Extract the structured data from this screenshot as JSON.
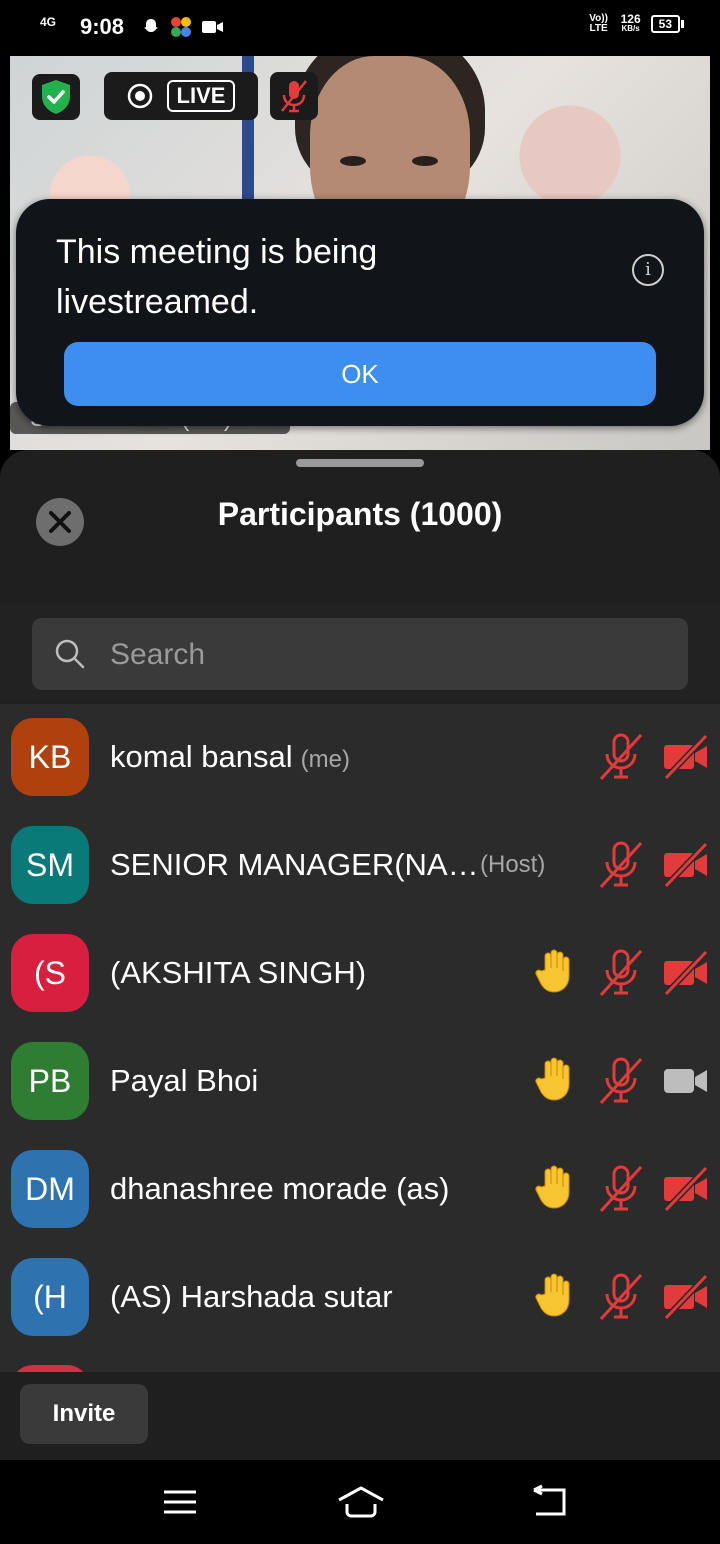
{
  "status_bar": {
    "network": "4G",
    "time": "9:08",
    "volte": "Vo)) LTE",
    "speed_value": "126",
    "speed_unit": "KB/s",
    "battery": "53"
  },
  "video": {
    "live_label": "LIVE",
    "participant_name_tag": "Shalini Yadav (Alh)"
  },
  "toast": {
    "message": "This meeting is being livestreamed.",
    "ok_label": "OK"
  },
  "participants_panel": {
    "title": "Participants (1000)",
    "search_placeholder": "Search",
    "invite_label": "Invite",
    "participants": [
      {
        "initials": "KB",
        "name": "komal bansal",
        "tag": "(me)",
        "role": "",
        "color": "#b0410e",
        "hand": false,
        "mic_muted": true,
        "cam_off": true
      },
      {
        "initials": "SM",
        "name": "SENIOR MANAGER(NA…",
        "tag": "",
        "role": "(Host)",
        "color": "#0a7a79",
        "hand": false,
        "mic_muted": true,
        "cam_off": true
      },
      {
        "initials": "(S",
        "name": "(AKSHITA SINGH)",
        "tag": "",
        "role": "",
        "color": "#d81f3f",
        "hand": true,
        "mic_muted": true,
        "cam_off": true
      },
      {
        "initials": "PB",
        "name": "Payal Bhoi",
        "tag": "",
        "role": "",
        "color": "#2e7d32",
        "hand": true,
        "mic_muted": true,
        "cam_off": false
      },
      {
        "initials": "DM",
        "name": "dhanashree morade (as)",
        "tag": "",
        "role": "",
        "color": "#2f72b0",
        "hand": true,
        "mic_muted": true,
        "cam_off": true
      },
      {
        "initials": "(H",
        "name": "(AS) Harshada sutar",
        "tag": "",
        "role": "",
        "color": "#2f72b0",
        "hand": true,
        "mic_muted": true,
        "cam_off": true
      }
    ]
  },
  "colors": {
    "muted_red": "#e23b3b",
    "hand_yellow": "#f7c531",
    "ok_blue": "#3d8ef0"
  },
  "icons": [
    "shield-check-icon",
    "record-icon",
    "mic-off-icon",
    "info-icon",
    "close-icon",
    "search-icon",
    "raise-hand-icon",
    "video-off-icon",
    "video-icon",
    "menu-icon",
    "home-icon",
    "back-icon"
  ]
}
